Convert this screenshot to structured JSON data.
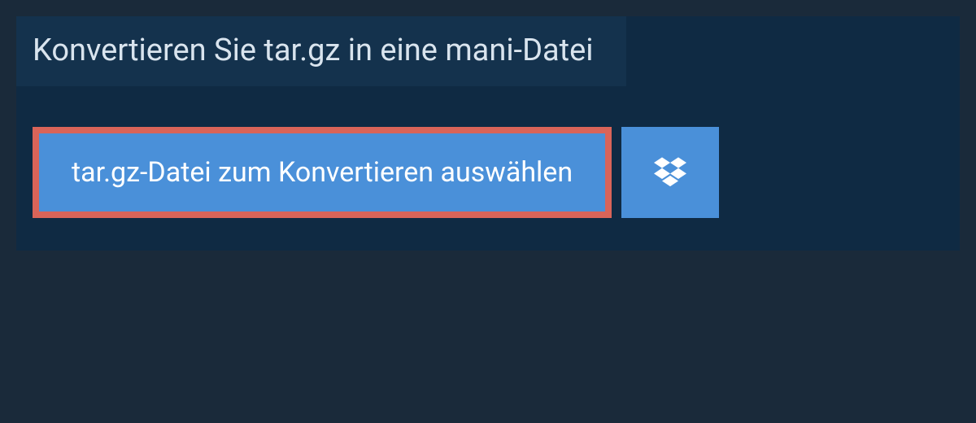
{
  "converter": {
    "heading": "Konvertieren Sie tar.gz in eine mani-Datei",
    "file_select_label": "tar.gz-Datei zum Konvertieren auswählen"
  },
  "icons": {
    "dropbox": "dropbox-icon"
  },
  "colors": {
    "panel_bg": "#0f2a43",
    "heading_bg": "#14324d",
    "button_bg": "#4a90d9",
    "button_border": "#d96459",
    "page_bg": "#1a2a3a"
  }
}
